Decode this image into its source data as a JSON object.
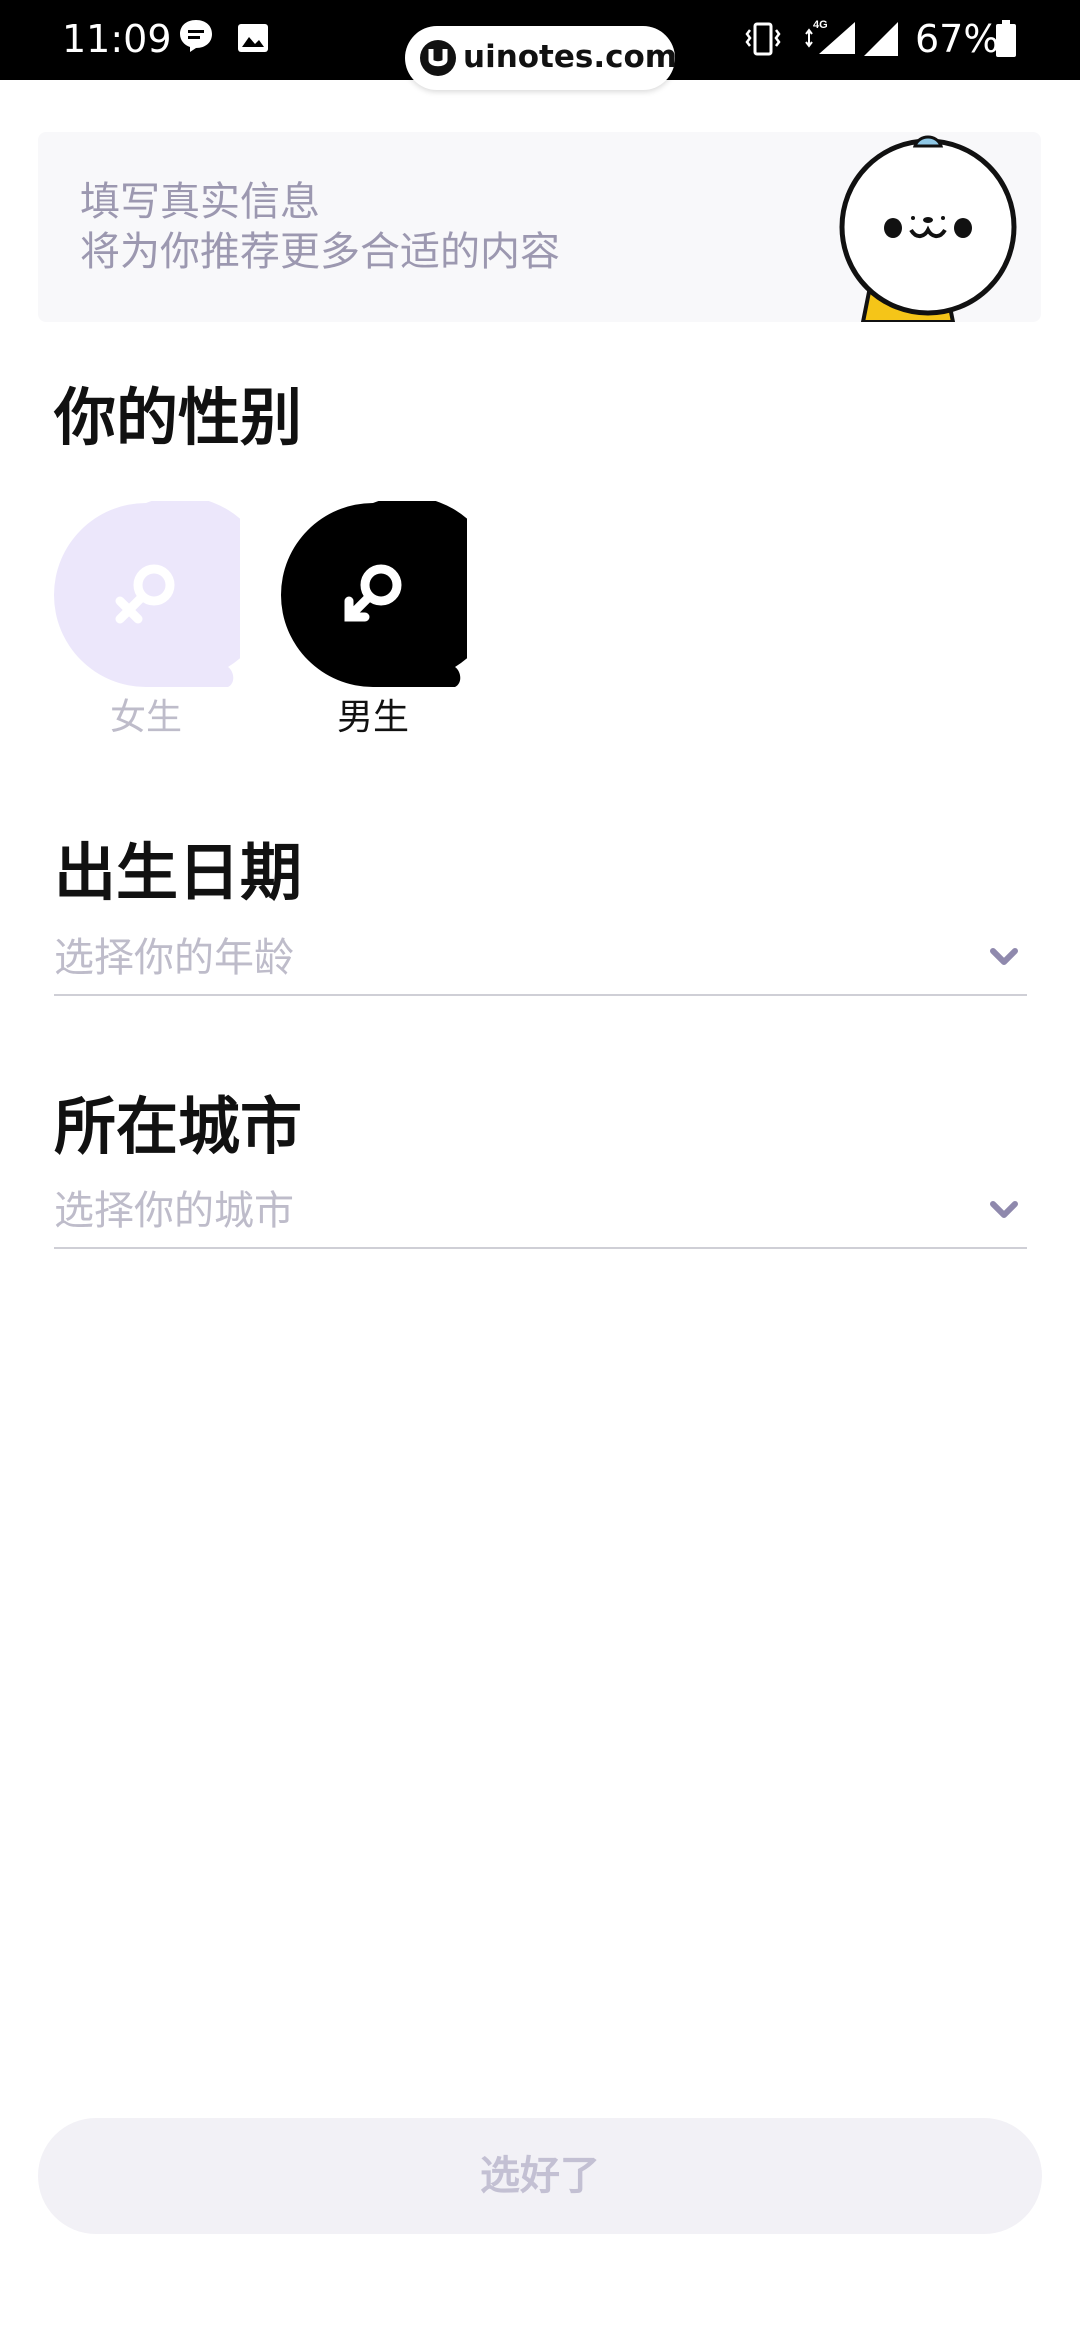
{
  "status_bar": {
    "time": "11:09",
    "network": "4G",
    "battery": "67%",
    "icons": [
      "message-icon",
      "image-icon",
      "vibrate-icon",
      "signal-icon",
      "battery-icon"
    ]
  },
  "watermark": {
    "url": "uinotes.com"
  },
  "banner": {
    "line1": "填写真实信息",
    "line2": "将为你推荐更多合适的内容"
  },
  "gender": {
    "title": "你的性别",
    "options": [
      {
        "label": "女生",
        "icon": "female-icon",
        "selected": false
      },
      {
        "label": "男生",
        "icon": "male-icon",
        "selected": true
      }
    ]
  },
  "birth": {
    "title": "出生日期",
    "placeholder": "选择你的年龄"
  },
  "city": {
    "title": "所在城市",
    "placeholder": "选择你的城市"
  },
  "confirm": {
    "label": "选好了"
  },
  "colors": {
    "accent_light": "#ece7fb",
    "text_muted": "#9c98b0",
    "placeholder": "#bebcca",
    "button_bg": "#f2f1f6",
    "button_text": "#c3c0d3",
    "mascot_jacket": "#f5c518"
  }
}
